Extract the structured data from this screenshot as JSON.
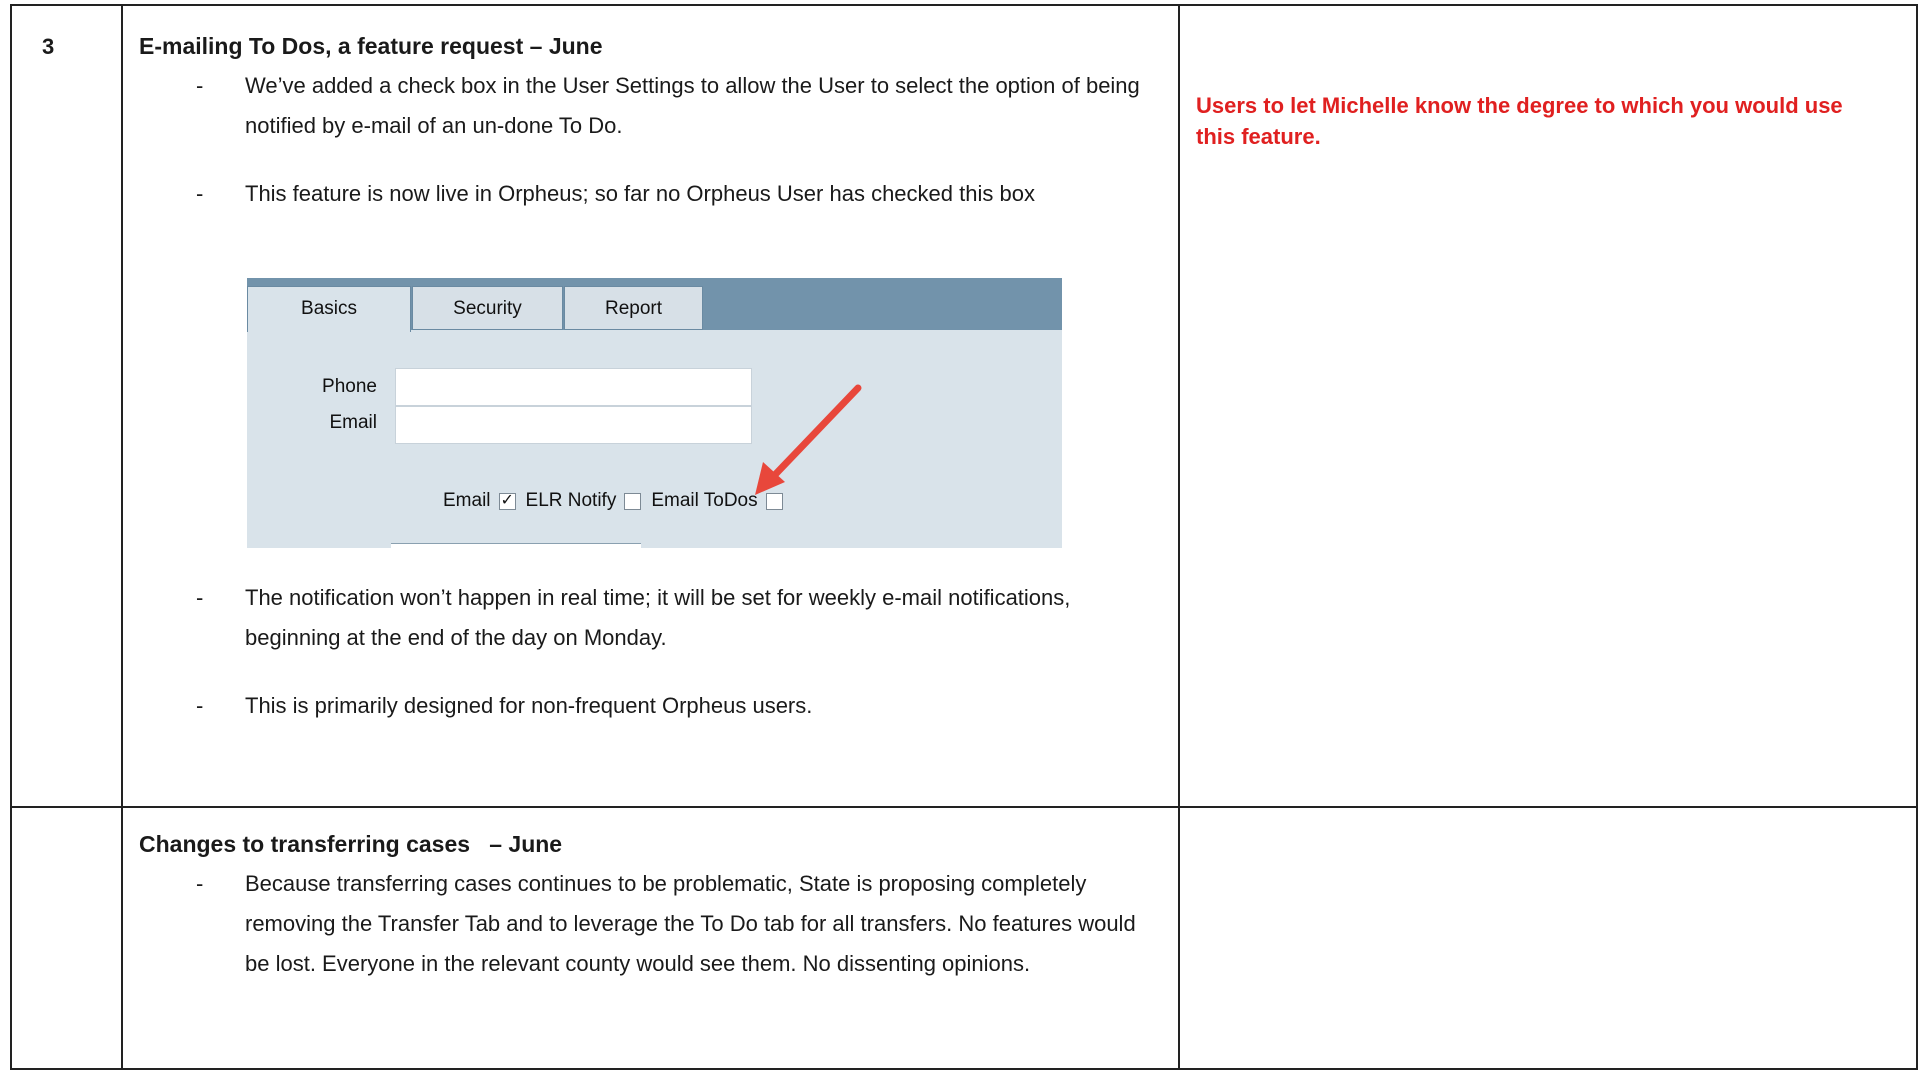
{
  "rows": [
    {
      "number": "3",
      "title": "E-mailing To Dos, a feature request – June",
      "bullets_before": [
        "We’ve added a check box in the User Settings to allow the User to select the option of being notified by e-mail of an un-done To Do.",
        "This feature is now live in Orpheus; so far no Orpheus User has checked this box"
      ],
      "screenshot": {
        "tabs": [
          "Basics",
          "Security",
          "Report"
        ],
        "active_tab": "Basics",
        "fields": [
          {
            "label": "Phone",
            "value": ""
          },
          {
            "label": "Email",
            "value": ""
          }
        ],
        "checkboxes": [
          {
            "label": "Email",
            "checked": true
          },
          {
            "label": "ELR Notify",
            "checked": false
          },
          {
            "label": "Email ToDos",
            "checked": false
          }
        ],
        "tabbar_color": "#7293ab",
        "panel_color": "#d9e3ea",
        "arrow_color": "#e8473b"
      },
      "bullets_after": [
        "The notification won’t happen in real time; it will be set for weekly e-mail notifications, beginning at the end of the day on Monday.",
        "This is primarily designed for non-frequent Orpheus users."
      ],
      "notes": "Users to let Michelle know the degree to which you would use this feature."
    },
    {
      "number": "",
      "title": "Changes to transferring cases   – June",
      "bullets": [
        "Because transferring cases continues to be problematic, State is proposing completely removing the Transfer Tab and to leverage the To Do tab for all transfers. No features would be lost. Everyone in the relevant county would see them. No dissenting opinions."
      ],
      "notes": ""
    }
  ],
  "colors": {
    "notes_red": "#e02020",
    "border": "#222222"
  }
}
